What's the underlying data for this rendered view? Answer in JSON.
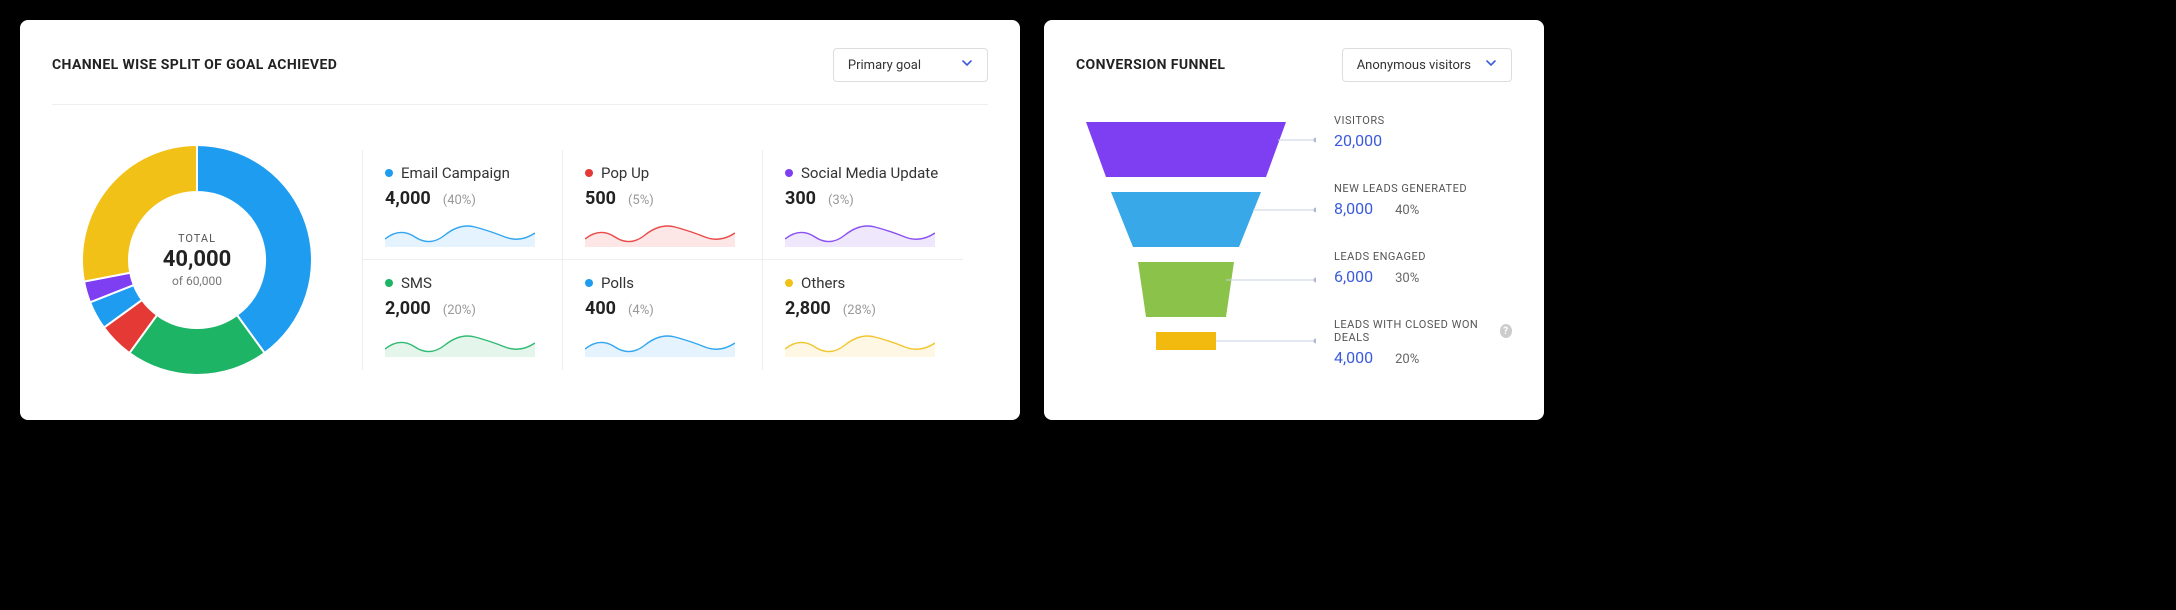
{
  "left": {
    "title": "CHANNEL WISE SPLIT OF GOAL ACHIEVED",
    "dropdown": "Primary goal",
    "donut": {
      "label": "TOTAL",
      "value": "40,000",
      "sub": "of 60,000"
    },
    "channels": [
      {
        "name": "Email Campaign",
        "value": "4,000",
        "pct": "(40%)",
        "color": "#1e9df0"
      },
      {
        "name": "Pop Up",
        "value": "500",
        "pct": "(5%)",
        "color": "#e53935"
      },
      {
        "name": "Social Media Update",
        "value": "300",
        "pct": "(3%)",
        "color": "#7e3ff2"
      },
      {
        "name": "SMS",
        "value": "2,000",
        "pct": "(20%)",
        "color": "#1db466"
      },
      {
        "name": "Polls",
        "value": "400",
        "pct": "(4%)",
        "color": "#1e9df0"
      },
      {
        "name": "Others",
        "value": "2,800",
        "pct": "(28%)",
        "color": "#f2c118"
      }
    ]
  },
  "right": {
    "title": "CONVERSION FUNNEL",
    "dropdown": "Anonymous visitors",
    "stages": [
      {
        "label": "VISITORS",
        "value": "20,000",
        "pct": "",
        "color": "#7e3ff2"
      },
      {
        "label": "NEW LEADS GENERATED",
        "value": "8,000",
        "pct": "40%",
        "color": "#38a8e8"
      },
      {
        "label": "LEADS ENGAGED",
        "value": "6,000",
        "pct": "30%",
        "color": "#8bc34a"
      },
      {
        "label": "LEADS WITH CLOSED WON DEALS",
        "value": "4,000",
        "pct": "20%",
        "color": "#f2b90f",
        "help": true
      }
    ]
  },
  "chart_data": [
    {
      "type": "pie",
      "title": "Channel wise split of goal achieved",
      "total": 40000,
      "target": 60000,
      "series": [
        {
          "name": "Email Campaign",
          "value": 4000,
          "pct": 40
        },
        {
          "name": "Pop Up",
          "value": 500,
          "pct": 5
        },
        {
          "name": "Social Media Update",
          "value": 300,
          "pct": 3
        },
        {
          "name": "SMS",
          "value": 2000,
          "pct": 20
        },
        {
          "name": "Polls",
          "value": 400,
          "pct": 4
        },
        {
          "name": "Others",
          "value": 2800,
          "pct": 28
        }
      ]
    },
    {
      "type": "bar",
      "title": "Conversion Funnel",
      "categories": [
        "Visitors",
        "New Leads Generated",
        "Leads Engaged",
        "Leads with Closed Won Deals"
      ],
      "values": [
        20000,
        8000,
        6000,
        4000
      ],
      "pct_of_visitors": [
        100,
        40,
        30,
        20
      ]
    }
  ]
}
